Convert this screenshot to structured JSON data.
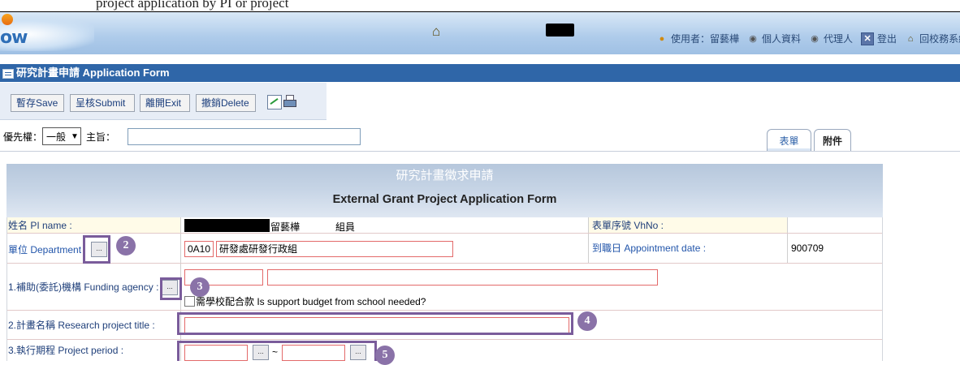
{
  "top_strip_text": "project application by PI or project",
  "header": {
    "logo_text": "ow",
    "user_label": "使用者：留藝樺",
    "profile_label": "個人資料",
    "proxy_label": "代理人",
    "logout_label": "登出",
    "back_label": "回校務系統"
  },
  "title_bar": {
    "title": "研究計畫申請 Application Form"
  },
  "toolbar": {
    "save_label": "暫存Save",
    "submit_label": "呈核Submit",
    "exit_label": "離開Exit",
    "delete_label": "撤銷Delete"
  },
  "priority": {
    "label": "優先權：",
    "selected": "一般",
    "subject_label": "主旨：",
    "subject_value": ""
  },
  "tabs": {
    "form": "表單",
    "attachment": "附件"
  },
  "form": {
    "title_zh": "研究計畫徵求申請",
    "title_en": "External Grant Project Application Form",
    "pi_label": "姓名 PI name :",
    "pi_name": "留藝樺",
    "pi_title": "組員",
    "vhno_label": "表單序號 VhNo :",
    "vhno_value": "",
    "dept_label": "單位 Department",
    "dept_code": "0A10",
    "dept_name": "研發處研發行政組",
    "appt_label": "到職日 Appointment date :",
    "appt_value": "900709",
    "agency_label": "1.補助(委託)機構 Funding agency :",
    "agency_code": "",
    "agency_name": "",
    "school_budget_label": "需學校配合款 Is support budget from school needed?",
    "title_label": "2.計畫名稱 Research project title :",
    "title_value": "",
    "period_label": "3.執行期程 Project period :",
    "period_sep": "~",
    "period_start": "",
    "period_end": "",
    "ellipsis": "..."
  },
  "callouts": [
    "2",
    "3",
    "4",
    "5"
  ]
}
